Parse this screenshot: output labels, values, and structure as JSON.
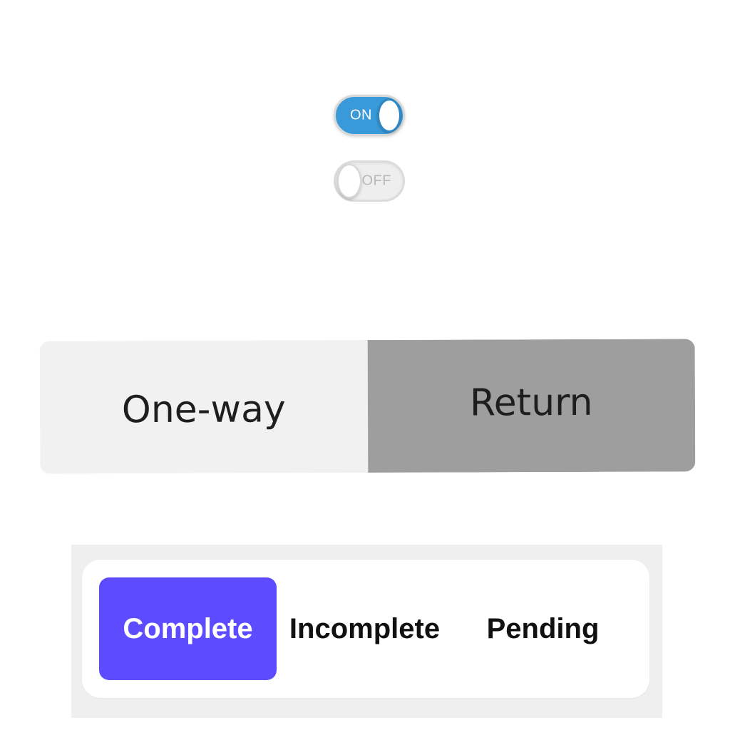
{
  "toggles": {
    "on": {
      "label": "ON",
      "state": true,
      "color": "#3a9ad9"
    },
    "off": {
      "label": "OFF",
      "state": false,
      "color": "#eeeeee"
    }
  },
  "trip_type": {
    "options": [
      "One-way",
      "Return"
    ],
    "selected": "Return",
    "selected_color": "#9e9e9e",
    "unselected_color": "#f1f1f1"
  },
  "status": {
    "options": [
      "Complete",
      "Incomplete",
      "Pending"
    ],
    "selected": "Complete",
    "accent": "#5d4cff"
  }
}
